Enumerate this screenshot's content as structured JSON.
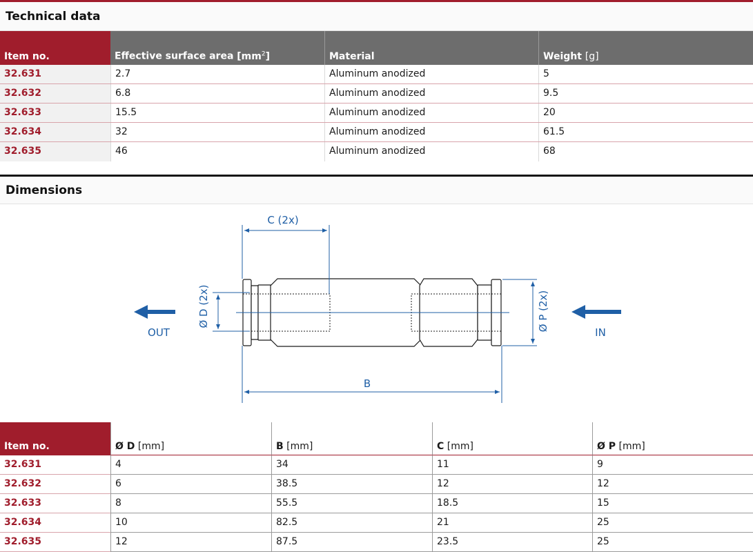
{
  "technical_data": {
    "title": "Technical data",
    "headers": {
      "item": "Item no.",
      "area": "Effective surface area",
      "area_unit_pre": "[mm",
      "area_unit_sup": "2",
      "area_unit_post": "]",
      "material": "Material",
      "weight": "Weight",
      "weight_unit": "[g]"
    },
    "rows": [
      {
        "item": "32.631",
        "area": "2.7",
        "material": "Aluminum anodized",
        "weight": "5"
      },
      {
        "item": "32.632",
        "area": "6.8",
        "material": "Aluminum anodized",
        "weight": "9.5"
      },
      {
        "item": "32.633",
        "area": "15.5",
        "material": "Aluminum anodized",
        "weight": "20"
      },
      {
        "item": "32.634",
        "area": "32",
        "material": "Aluminum anodized",
        "weight": "61.5"
      },
      {
        "item": "32.635",
        "area": "46",
        "material": "Aluminum anodized",
        "weight": "68"
      }
    ]
  },
  "dimensions": {
    "title": "Dimensions",
    "drawing": {
      "label_c": "C (2x)",
      "label_d": "Ø D (2x)",
      "label_p": "Ø P (2x)",
      "label_b": "B",
      "out": "OUT",
      "in": "IN"
    },
    "headers": {
      "item": "Item no.",
      "d": "Ø D",
      "d_unit": "[mm]",
      "b": "B",
      "b_unit": "[mm]",
      "c": "C",
      "c_unit": "[mm]",
      "p": "Ø P",
      "p_unit": "[mm]"
    },
    "rows": [
      {
        "item": "32.631",
        "d": "4",
        "b": "34",
        "c": "11",
        "p": "9"
      },
      {
        "item": "32.632",
        "d": "6",
        "b": "38.5",
        "c": "12",
        "p": "12"
      },
      {
        "item": "32.633",
        "d": "8",
        "b": "55.5",
        "c": "18.5",
        "p": "15"
      },
      {
        "item": "32.634",
        "d": "10",
        "b": "82.5",
        "c": "21",
        "p": "25"
      },
      {
        "item": "32.635",
        "d": "12",
        "b": "87.5",
        "c": "23.5",
        "p": "25"
      }
    ]
  },
  "colors": {
    "brand_red": "#a01d2c",
    "header_grey": "#6d6d6d",
    "drawing_blue": "#1f5fa6"
  }
}
